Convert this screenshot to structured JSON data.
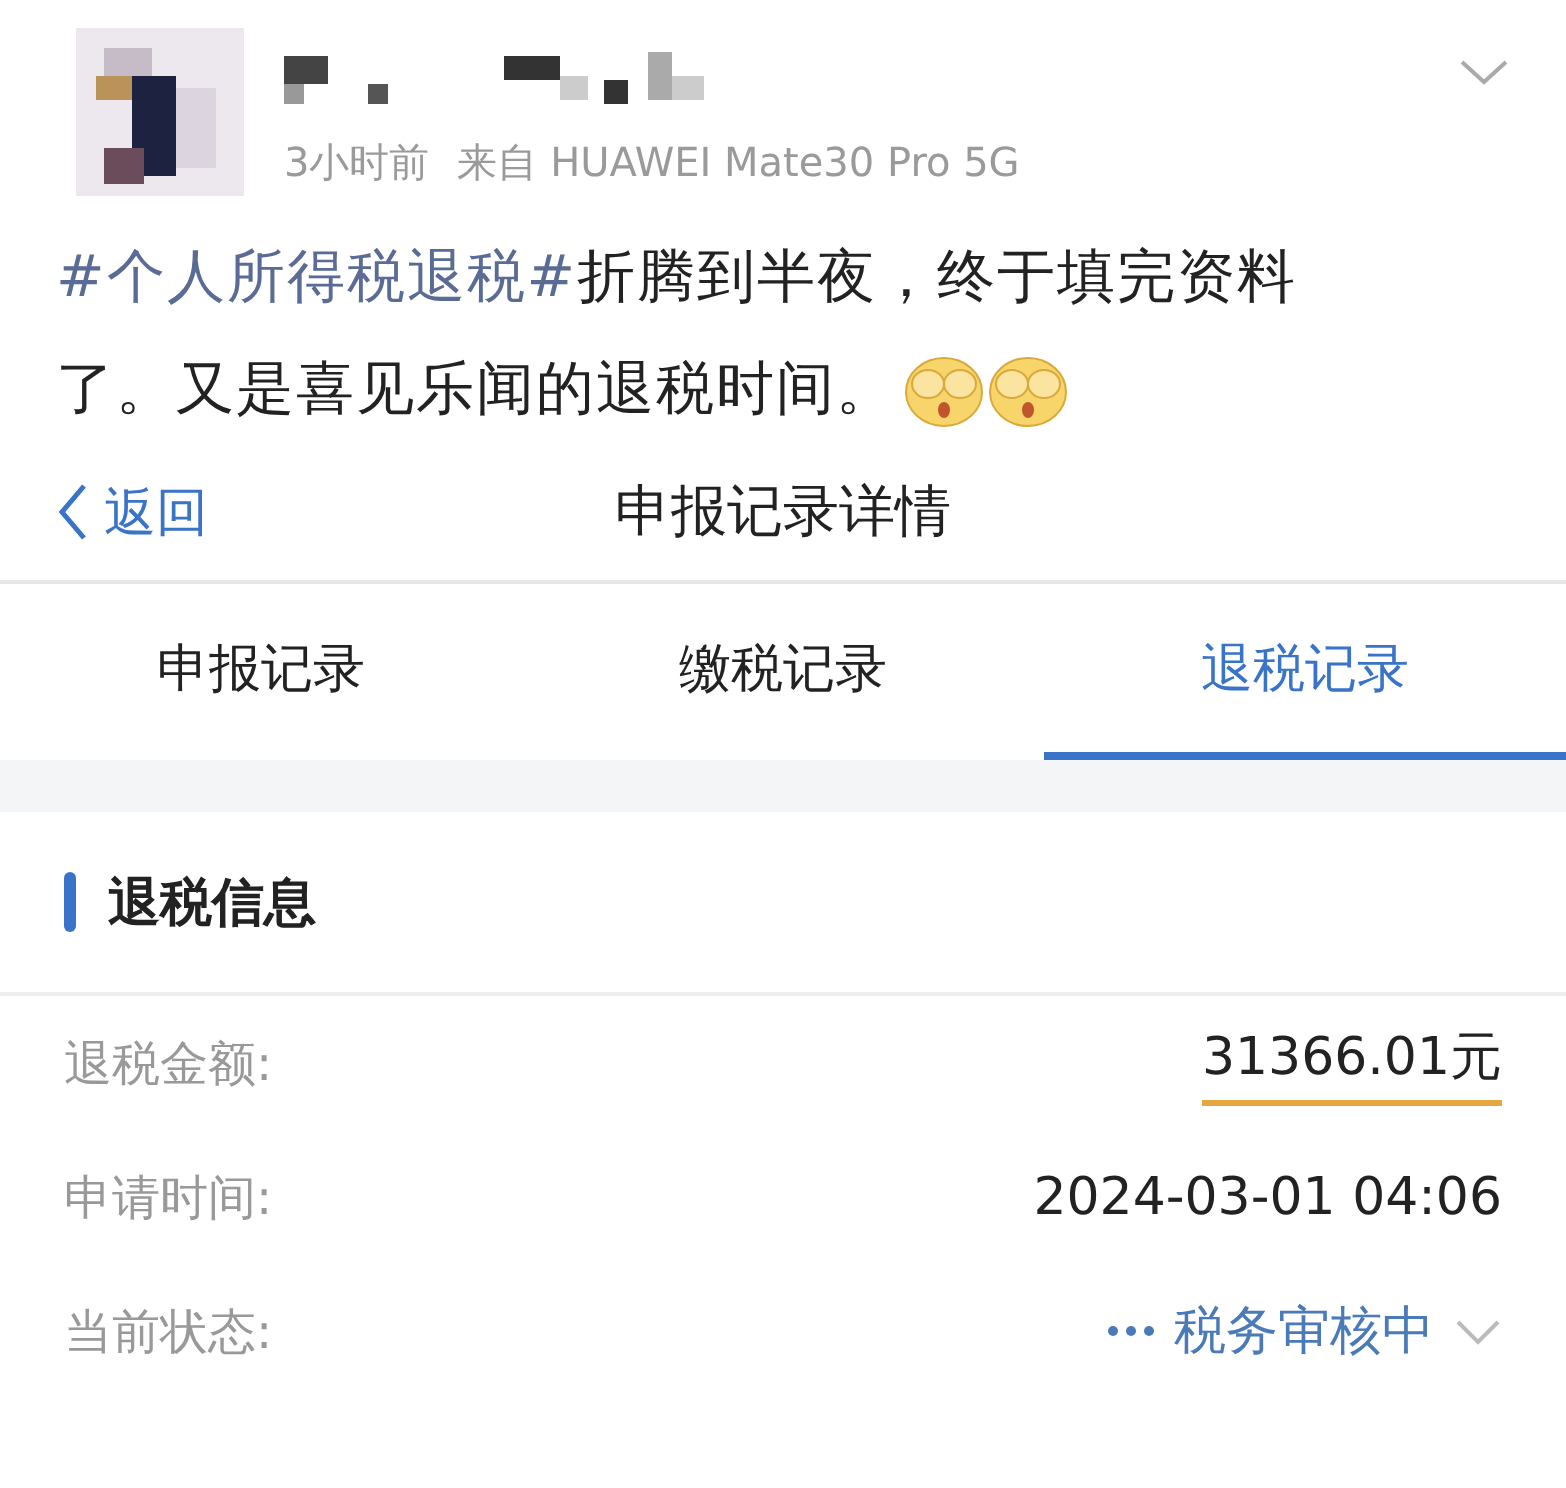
{
  "post": {
    "time": "3小时前",
    "source": "来自 HUAWEI Mate30 Pro 5G",
    "hashtag": "#个人所得税退税#",
    "body": "折腾到半夜，终于填完资料了。又是喜见乐闻的退税时间。"
  },
  "nav": {
    "back": "返回",
    "title": "申报记录详情"
  },
  "tabs": [
    {
      "label": "申报记录",
      "selected": false
    },
    {
      "label": "缴税记录",
      "selected": false
    },
    {
      "label": "退税记录",
      "selected": true
    }
  ],
  "section": {
    "title": "退税信息"
  },
  "rows": [
    {
      "kind": "amount",
      "label": "退税金额:",
      "value": "31366.01元"
    },
    {
      "kind": "plain",
      "label": "申请时间:",
      "value": "2024-03-01 04:06"
    },
    {
      "kind": "status",
      "label": "当前状态:",
      "value": "税务审核中"
    }
  ]
}
